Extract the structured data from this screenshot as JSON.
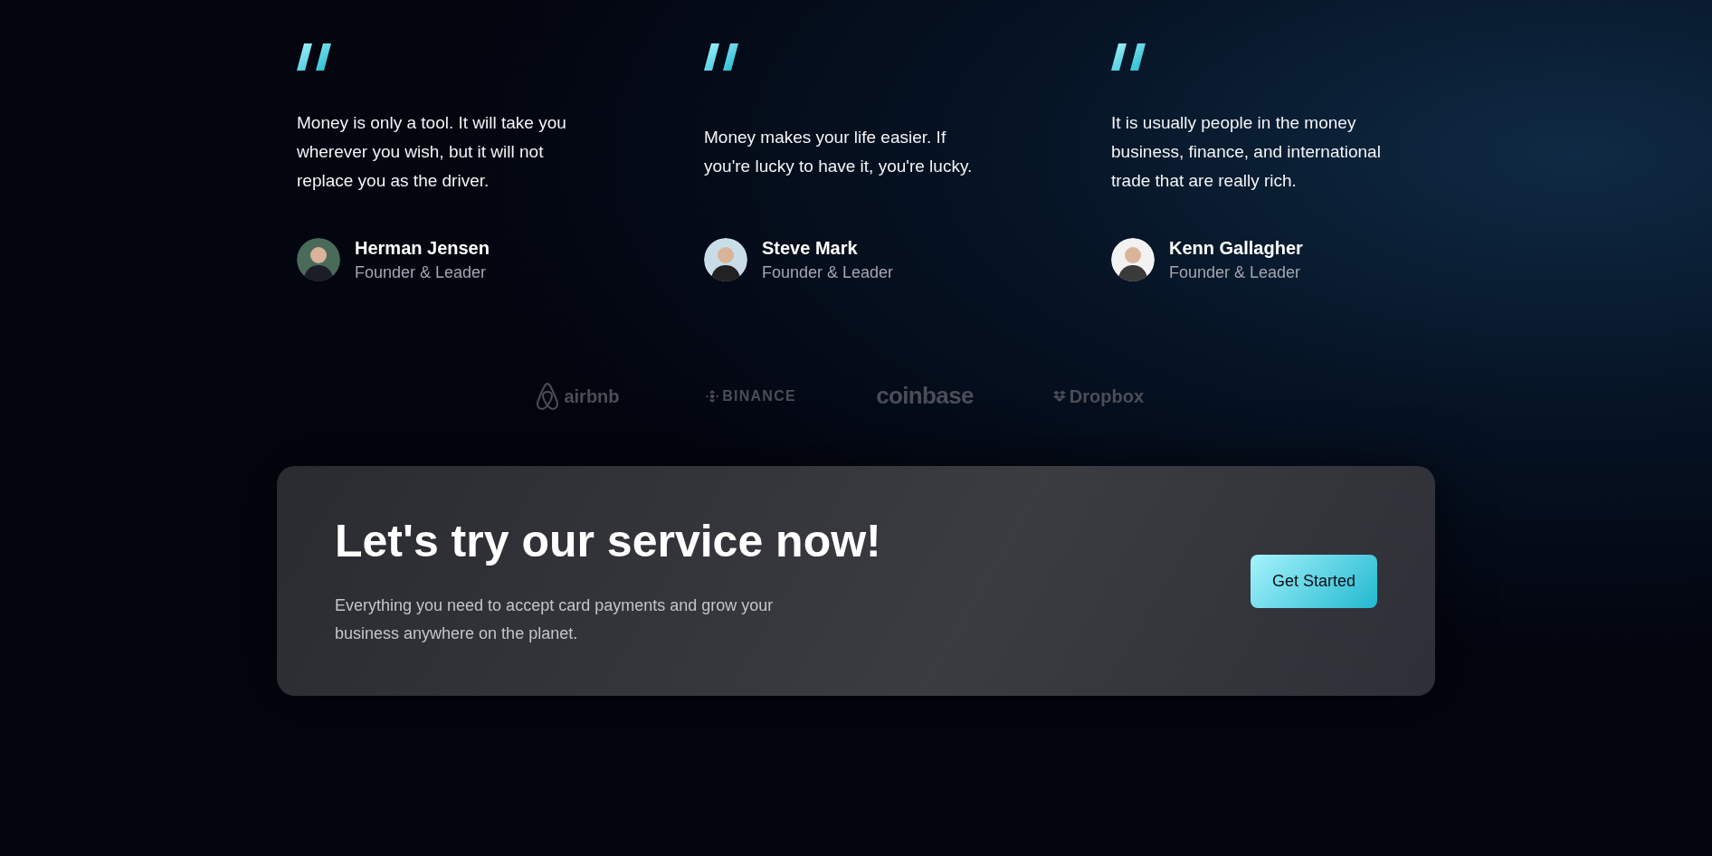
{
  "testimonials": [
    {
      "quote": "Money is only a tool. It will take you wherever you wish, but it will not replace you as the driver.",
      "name": "Herman Jensen",
      "role": "Founder & Leader"
    },
    {
      "quote": "Money makes your life easier. If you're lucky to have it, you're lucky.",
      "name": "Steve Mark",
      "role": "Founder & Leader"
    },
    {
      "quote": "It is usually people in the money business, finance, and international trade that are really rich.",
      "name": "Kenn Gallagher",
      "role": "Founder & Leader"
    }
  ],
  "partners": [
    {
      "kind": "airbnb",
      "label": "airbnb"
    },
    {
      "kind": "binance",
      "label": "BINANCE"
    },
    {
      "kind": "coinbase",
      "label": "coinbase"
    },
    {
      "kind": "dropbox",
      "label": "Dropbox"
    }
  ],
  "cta": {
    "title": "Let's try our service now!",
    "text": "Everything you need to accept card payments and grow your business anywhere on the planet.",
    "button": "Get Started"
  }
}
